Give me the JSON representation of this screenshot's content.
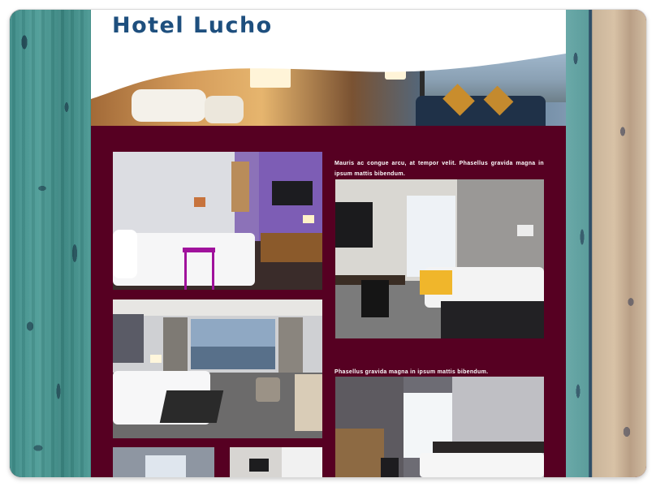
{
  "site": {
    "title": "Hotel Lucho"
  },
  "content": {
    "caption_1": "Mauris ac congue arcu, at tempor velit. Phasellus gravida magna in ipsum mattis bibendum.",
    "caption_2": "Phasellus gravida magna in ipsum mattis bibendum."
  },
  "colors": {
    "title_blue": "#1e4f7e",
    "content_bg": "#560022",
    "header_bg": "#ffffff"
  },
  "images": [
    "hotel-room-banner",
    "room-purple-wall",
    "room-tv-desk",
    "room-panoramic-window",
    "room-twin-beds",
    "room-thumbnail-a",
    "room-thumbnail-b"
  ]
}
